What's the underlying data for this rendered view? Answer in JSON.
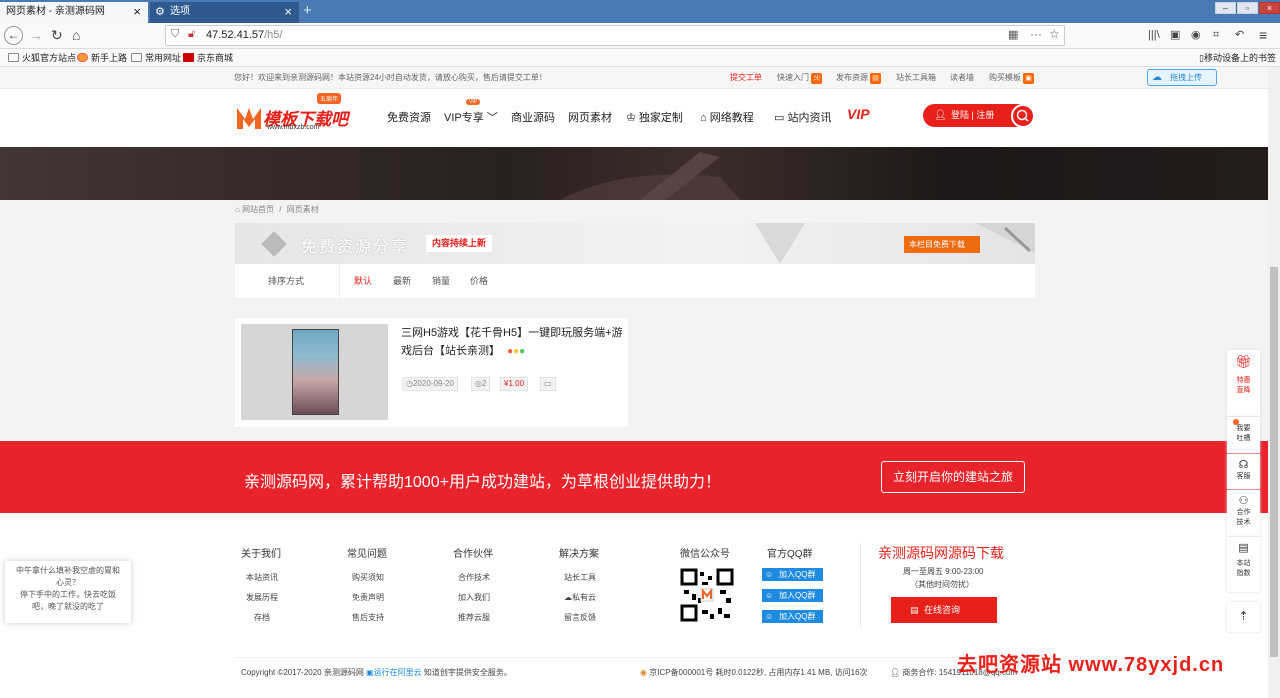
{
  "browser": {
    "tabs": [
      {
        "label": "网页素材 - 亲测源码网"
      },
      {
        "label": "选项"
      }
    ],
    "new_tab": "+",
    "url_host": "47.52.41.57",
    "url_path": "/h5/",
    "bookmarks": [
      "火狐官方站点",
      "新手上路",
      "常用网址",
      "京东商城"
    ],
    "mobile_bookmarks": "移动设备上的书签"
  },
  "topbar": {
    "welcome": "您好！欢迎来到亲测源码网！本站资源24小时自动发货，请放心购买，售后请提交工单！",
    "links": [
      "提交工单",
      "快速入门",
      "发布资源",
      "站长工具箱",
      "读者墙",
      "购买模板"
    ],
    "upload": "拖拽上传"
  },
  "header": {
    "logo_text": "模板下载吧",
    "logo_sub": "www.mbxzb.com",
    "logo_badge": "五周年",
    "nav": [
      "免费资源",
      "VIP专享",
      "商业源码",
      "网页素材",
      "独家定制",
      "网络教程",
      "站内资讯"
    ],
    "vip_badge": "VIP",
    "vip_logo": "VIP",
    "login": "登陆 | 注册"
  },
  "breadcrumb": {
    "home": "网站首页",
    "sep": "/",
    "current": "网页素材"
  },
  "category": {
    "title": "免费资源分享",
    "tag": "内容持续上新",
    "download": "本栏目免费下载",
    "sort_label": "排序方式",
    "sort_options": [
      "默认",
      "最新",
      "销量",
      "价格"
    ]
  },
  "card": {
    "title": "三网H5游戏【花千骨H5】一键即玩服务端+游戏后台【站长亲测】",
    "date": "2020-09-20",
    "views": "2",
    "price": "1.00"
  },
  "promo": {
    "text": "亲测源码网，累计帮助1000+用户成功建站，为草根创业提供助力！",
    "button": "立刻开启你的建站之旅"
  },
  "footer": {
    "columns": [
      {
        "title": "关于我们",
        "items": [
          "本站资讯",
          "发展历程",
          "存档"
        ]
      },
      {
        "title": "常见问题",
        "items": [
          "购买须知",
          "免责声明",
          "售后支持"
        ]
      },
      {
        "title": "合作伙伴",
        "items": [
          "合作技术",
          "加入我们",
          "推荐云服"
        ]
      },
      {
        "title": "解决方案",
        "items": [
          "站长工具",
          "私有云",
          "留言反馈"
        ]
      }
    ],
    "wechat_title": "微信公众号",
    "qq_title": "官方QQ群",
    "qq_buttons": [
      "加入QQ群",
      "加入QQ群",
      "加入QQ群"
    ],
    "big_title": "亲测源码网源码下载",
    "hours": "周一至周五 9:00-23:00",
    "hours_note": "（其他时间勿扰）",
    "consult": "在线咨询",
    "copyright_prefix": "Copyright ©2017-2020 亲测源码网",
    "cloud": "运行在阿里云",
    "copyright_suffix": "知道创宇提供安全服务。",
    "icp": "京ICP备000001号 耗时0.0122秒, 占用内存1.41 MB, 访问16次",
    "biz_mail": "商务合作: 1541911018@qq.com",
    "watermark": "去吧资源站 www.78yxjd.cn"
  },
  "tip": {
    "lines": [
      "中午拿什么填补我空虚的胃和",
      "心灵？",
      "停下手中的工作，快去吃饭",
      "吧，晚了就没的吃了"
    ]
  },
  "right_float": [
    {
      "label": "特惠直降"
    },
    {
      "label": "我要吐槽"
    },
    {
      "label": "客服"
    },
    {
      "label": "合作技术"
    },
    {
      "label": "本站指数"
    }
  ],
  "colors": {
    "accent": "#e8201a",
    "vip_orange": "#ee6b12",
    "qq_blue": "#1e8be0"
  }
}
